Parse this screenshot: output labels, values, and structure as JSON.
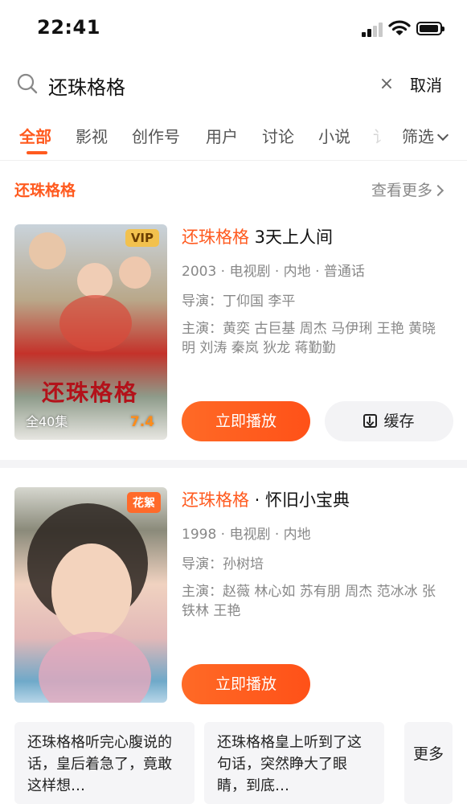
{
  "status_bar": {
    "time": "22:41"
  },
  "search": {
    "query": "还珠格格",
    "clear_symbol": "×",
    "cancel_label": "取消"
  },
  "tabs": [
    {
      "label": "全部",
      "active": true
    },
    {
      "label": "影视"
    },
    {
      "label": "创作号"
    },
    {
      "label": "用户"
    },
    {
      "label": "讨论"
    },
    {
      "label": "小说"
    },
    {
      "label": "讠"
    }
  ],
  "filter_label": "筛选",
  "section": {
    "title": "还珠格格",
    "more_label": "查看更多"
  },
  "cards": [
    {
      "badge": "VIP",
      "poster_art_text": "还珠格格",
      "episodes": "全40集",
      "rating": "7.4",
      "title_highlight": "还珠格格",
      "title_rest": " 3天上人间",
      "meta": "2003 · 电视剧 · 内地 · 普通话",
      "director": "导演：丁仰国 李平",
      "cast": "主演：黄奕 古巨基 周杰 马伊琍 王艳 黄晓明 刘涛 秦岚 狄龙 蒋勤勤",
      "play_label": "立即播放",
      "download_label": "缓存"
    },
    {
      "badge": "花絮",
      "title_highlight": "还珠格格",
      "title_rest": " · 怀旧小宝典",
      "meta": "1998 · 电视剧 · 内地",
      "director": "导演：孙树培",
      "cast": "主演：赵薇 林心如 苏有朋 周杰 范冰冰 张铁林 王艳",
      "play_label": "立即播放"
    }
  ],
  "snippets": [
    "还珠格格听完心腹说的话，皇后着急了，竟敢这样想…",
    "还珠格格皇上听到了这句话，突然睁大了眼睛，到底…"
  ],
  "more_card_label": "更多",
  "colors": {
    "accent": "#ff5a1f",
    "vip": "#f2c14e"
  },
  "icons": [
    "search-icon",
    "close-icon",
    "chevron-down-icon",
    "chevron-right-icon",
    "download-icon",
    "signal-icon",
    "wifi-icon",
    "battery-icon"
  ]
}
